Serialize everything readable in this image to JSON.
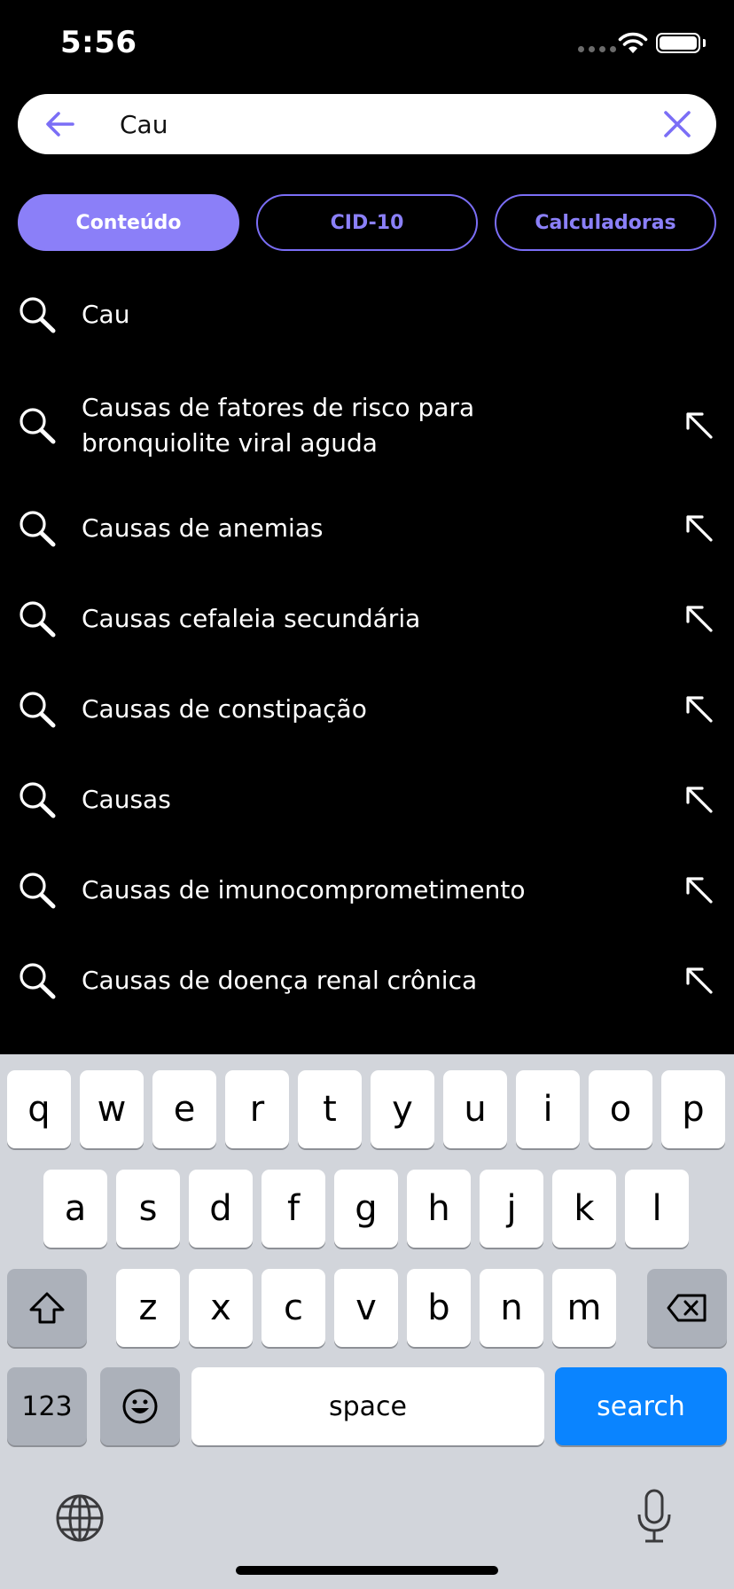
{
  "status": {
    "time": "5:56"
  },
  "search": {
    "value": "Cau"
  },
  "tabs": [
    {
      "label": "Conteúdo",
      "active": true
    },
    {
      "label": "CID-10",
      "active": false
    },
    {
      "label": "Calculadoras",
      "active": false
    }
  ],
  "results": [
    "Cau",
    "Causas de fatores de risco para bronquiolite viral aguda",
    "Causas de anemias",
    "Causas cefaleia secundária",
    "Causas de constipação",
    "Causas",
    "Causas de imunocomprometimento",
    "Causas de doença renal crônica"
  ],
  "keyboard": {
    "row1": [
      "q",
      "w",
      "e",
      "r",
      "t",
      "y",
      "u",
      "i",
      "o",
      "p"
    ],
    "row2": [
      "a",
      "s",
      "d",
      "f",
      "g",
      "h",
      "j",
      "k",
      "l"
    ],
    "row3": [
      "z",
      "x",
      "c",
      "v",
      "b",
      "n",
      "m"
    ],
    "numbers_label": "123",
    "space_label": "space",
    "search_label": "search",
    "icons": {
      "shift": "shift-icon",
      "delete": "delete-icon",
      "emoji": "emoji-icon",
      "globe": "globe-icon",
      "mic": "microphone-icon"
    }
  },
  "colors": {
    "accent": "#8b7ff8",
    "background": "#000000",
    "keyboard": "#d2d5db",
    "search_key": "#0a84ff"
  }
}
